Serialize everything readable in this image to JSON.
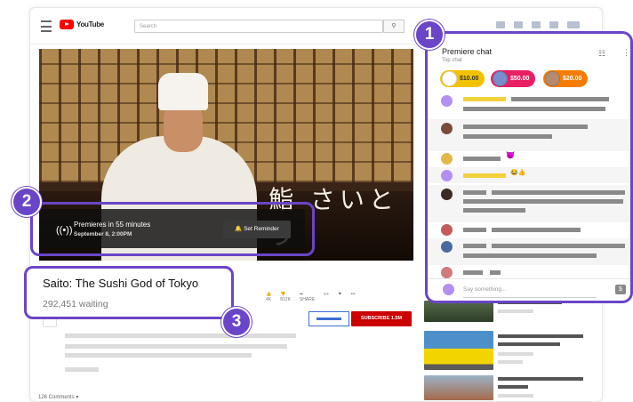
{
  "header": {
    "logo_text": "YouTube",
    "search_placeholder": "Search",
    "search_icon": "magnifier-icon"
  },
  "video": {
    "overlay_kanji": "鮨 さいとう",
    "premiere_text": "Premieres in 55 minutes",
    "premiere_date": "September 8, 2:00PM",
    "reminder_label": "Set Reminder"
  },
  "details": {
    "title": "Saito: The Sushi God of Tokyo",
    "waiting": "292,451 waiting",
    "likes": "4K",
    "dislikes": "812K",
    "share_label": "SHARE",
    "subscribe_label": "SUBSCRIBE",
    "subscriber_count": "1.5M",
    "comments_label": "126 Comments"
  },
  "chat": {
    "title": "Premiere chat",
    "subtitle": "Top chat",
    "superchats": [
      {
        "amount": "$10.00",
        "color": "#f2c200"
      },
      {
        "amount": "$50.00",
        "color": "#e91e63"
      },
      {
        "amount": "$20.00",
        "color": "#f57c00"
      }
    ],
    "input_placeholder": "Say something...",
    "emoji_1": "😈",
    "emoji_2": "😂👍"
  },
  "callouts": {
    "one": "1",
    "two": "2",
    "three": "3"
  },
  "colors": {
    "accent": "#6a45c7",
    "youtube_red": "#ff0000",
    "subscribe_red": "#cc0000"
  }
}
